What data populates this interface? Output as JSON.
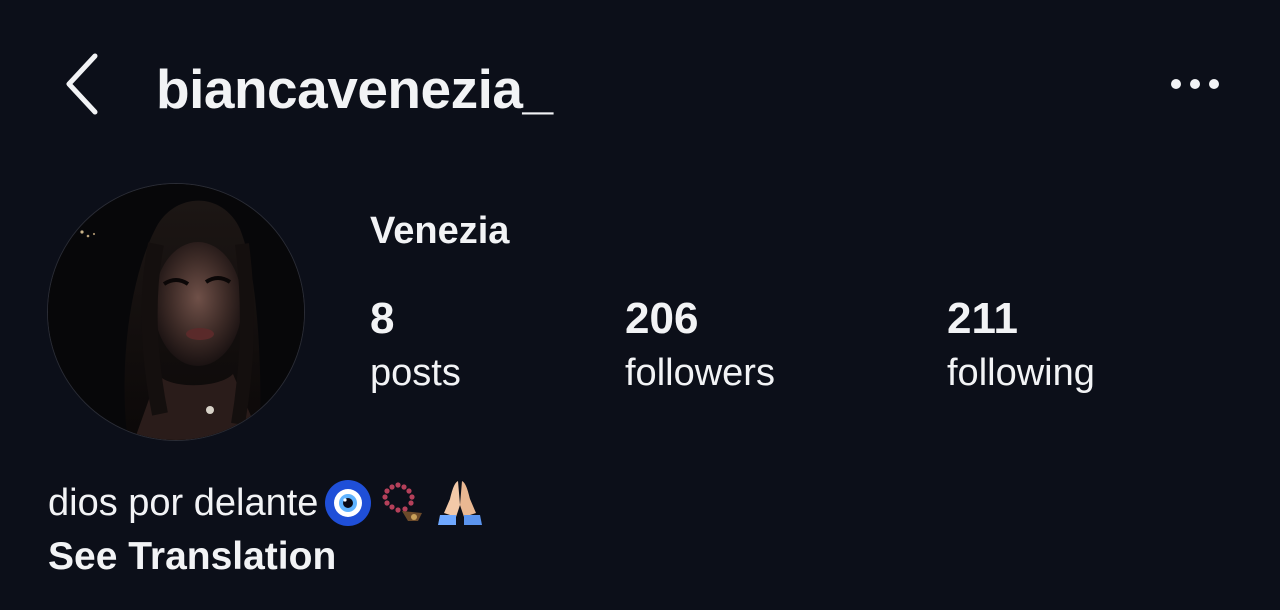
{
  "header": {
    "username": "biancavenezia_",
    "back_icon": "chevron-left-icon",
    "more_icon": "more-horizontal-icon"
  },
  "profile": {
    "display_name": "Venezia",
    "avatar": "profile-photo"
  },
  "stats": {
    "posts": {
      "count": "8",
      "label": "posts"
    },
    "followers": {
      "count": "206",
      "label": "followers"
    },
    "following": {
      "count": "211",
      "label": "following"
    }
  },
  "bio": {
    "text": "dios por delante",
    "emojis": [
      "nazar-amulet-emoji",
      "prayer-beads-emoji",
      "folded-hands-emoji"
    ],
    "translation_link": "See Translation"
  },
  "colors": {
    "background": "#0c0f19",
    "text": "#f2f3f5"
  }
}
